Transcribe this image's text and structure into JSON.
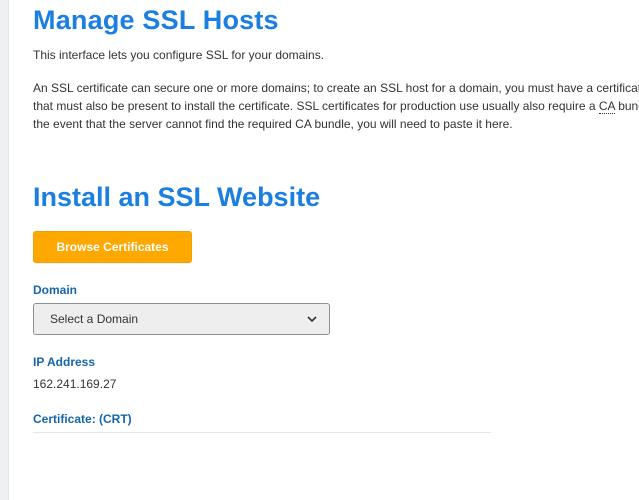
{
  "page": {
    "title": "Manage SSL Hosts",
    "intro": "This interface lets you configure SSL for your domains.",
    "description": {
      "line1": "An SSL certificate can secure one or more domains; to create an SSL host for a domain, you must have a certificate that s",
      "line2_before": "that must also be present to install the certificate. SSL certificates for production use usually also require a ",
      "line2_abbr": "CA",
      "line2_after": " bundle, wh",
      "line3": "the event that the server cannot find the required CA bundle, you will need to paste it here."
    }
  },
  "install_section": {
    "title": "Install an SSL Website",
    "browse_button_label": "Browse Certificates",
    "domain_label": "Domain",
    "domain_select_value": "Select a Domain",
    "ip_label": "IP Address",
    "ip_value": "162.241.169.27",
    "certificate_label": "Certificate: (CRT)",
    "certificate_value": ""
  },
  "icons": {
    "select_chevron": "chevron-down-icon"
  },
  "colors": {
    "heading": "#1a7fe0",
    "label": "#1565a8",
    "button": "#ffa800",
    "button_text": "#ffffff"
  }
}
